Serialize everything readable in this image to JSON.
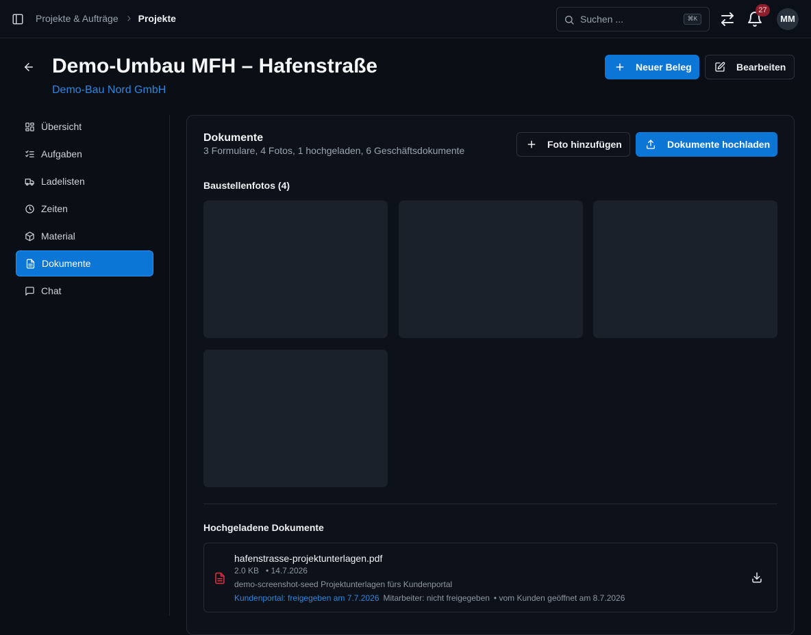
{
  "breadcrumb": {
    "parent": "Projekte & Aufträge",
    "current": "Projekte"
  },
  "search": {
    "placeholder": "Suchen ...",
    "shortcut": "⌘K"
  },
  "notifications": {
    "count": "27"
  },
  "user": {
    "initials": "MM"
  },
  "project": {
    "title": "Demo-Umbau MFH – Hafenstraße",
    "client": "Demo-Bau Nord GmbH"
  },
  "header_actions": {
    "new_document": "Neuer Beleg",
    "edit": "Bearbeiten"
  },
  "nav": {
    "items": [
      {
        "label": "Übersicht",
        "icon": "layout-grid-icon"
      },
      {
        "label": "Aufgaben",
        "icon": "list-checks-icon"
      },
      {
        "label": "Ladelisten",
        "icon": "truck-icon"
      },
      {
        "label": "Zeiten",
        "icon": "clock-icon"
      },
      {
        "label": "Material",
        "icon": "package-icon"
      },
      {
        "label": "Dokumente",
        "icon": "file-text-icon",
        "active": true
      },
      {
        "label": "Chat",
        "icon": "message-square-icon"
      }
    ]
  },
  "documents": {
    "title": "Dokumente",
    "summary": "3 Formulare, 4 Fotos, 1 hochgeladen, 6 Geschäftsdokumente",
    "add_photo": "Foto hinzufügen",
    "upload": "Dokumente hochladen",
    "photos_title": "Baustellenfotos (4)",
    "uploads_title": "Hochgeladene Dokumente",
    "uploaded": [
      {
        "name": "hafenstrasse-projektunterlagen.pdf",
        "size": "2.0 KB",
        "date": "14.7.2026",
        "description": "demo-screenshot-seed Projektunterlagen fürs Kundenportal",
        "portal_status": "Kundenportal: freigegeben am 7.7.2026",
        "staff_status": "Mitarbeiter: nicht freigegeben",
        "opened_status": "vom Kunden geöffnet am 8.7.2026"
      }
    ]
  },
  "colors": {
    "accent": "#0b76d6",
    "link": "#2e86de",
    "badge": "#8c1d2c",
    "pdf": "#e0323e"
  }
}
